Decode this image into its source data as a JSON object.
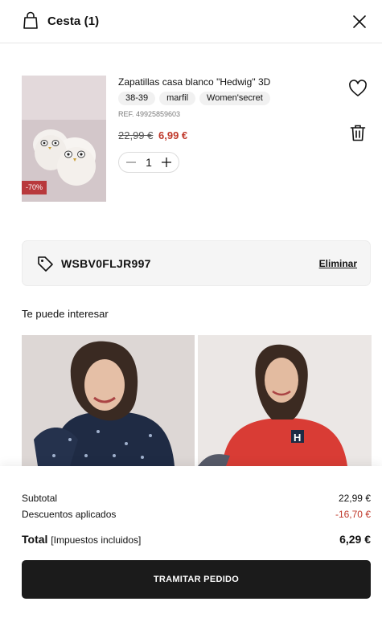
{
  "header": {
    "title": "Cesta (1)",
    "icons": {
      "bag": "shopping-bag-icon",
      "close": "close-icon"
    }
  },
  "cart": {
    "items": [
      {
        "name": "Zapatillas casa blanco \"Hedwig\" 3D",
        "chips": [
          "38-39",
          "marfil",
          "Women'secret"
        ],
        "ref": "REF. 49925859603",
        "old_price": "22,99 €",
        "new_price": "6,99 €",
        "discount_badge": "-70%",
        "quantity": "1",
        "image_icon": "slippers-image"
      }
    ]
  },
  "coupon": {
    "code": "WSBV0FLJR997",
    "remove_label": "Eliminar"
  },
  "recommendations": {
    "title": "Te puede interesar",
    "images": [
      "navy-pajama-model-image",
      "red-pajama-model-image"
    ]
  },
  "summary": {
    "subtotal_label": "Subtotal",
    "subtotal_value": "22,99 €",
    "discount_label": "Descuentos aplicados",
    "discount_value": "-16,70 €",
    "total_label": "Total",
    "total_note": "[Impuestos incluidos]",
    "total_value": "6,29 €",
    "checkout_label": "TRAMITAR PEDIDO"
  },
  "colors": {
    "accent_red": "#c0392b",
    "badge_red": "#b8393c",
    "button_dark": "#1b1b1b",
    "coupon_bg": "#f5f5f5"
  }
}
